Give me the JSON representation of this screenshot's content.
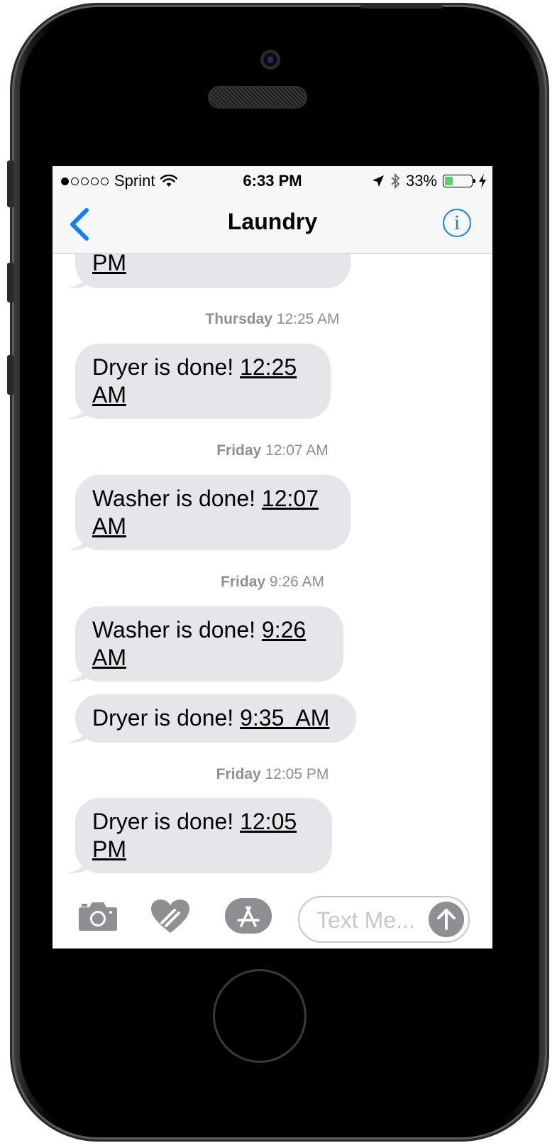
{
  "status_bar": {
    "carrier": "Sprint",
    "time": "6:33 PM",
    "battery_percent": "33%",
    "battery_level": 0.33,
    "battery_color": "#4cd964",
    "signal_bars": 1,
    "icons": [
      "wifi-icon",
      "location-arrow-icon",
      "bluetooth-icon",
      "battery-icon",
      "charging-bolt-icon"
    ]
  },
  "nav": {
    "title": "Laundry",
    "back_icon": "chevron-left-icon",
    "info_icon": "info-icon",
    "info_glyph": "i",
    "accent_color": "#147efb"
  },
  "messages": [
    {
      "type": "bubble",
      "text": "",
      "time": "PM",
      "partial": true
    },
    {
      "type": "timestamp",
      "day": "Thursday",
      "time": "12:25 AM"
    },
    {
      "type": "bubble",
      "text": "Dryer is done! ",
      "time_line1": "12:25",
      "time_line2": "AM"
    },
    {
      "type": "timestamp",
      "day": "Friday",
      "time": "12:07 AM"
    },
    {
      "type": "bubble",
      "text": "Washer is done! ",
      "time_line1": "12:07",
      "time_line2": "AM"
    },
    {
      "type": "timestamp",
      "day": "Friday",
      "time": "9:26 AM"
    },
    {
      "type": "bubble",
      "text": "Washer is done! ",
      "time_line1": "9:26",
      "time_line2": "AM"
    },
    {
      "type": "bubble",
      "text": "Dryer is done! ",
      "time_line1": "9:35  AM"
    },
    {
      "type": "timestamp",
      "day": "Friday",
      "time": "12:05 PM"
    },
    {
      "type": "bubble",
      "text": "Dryer is done! ",
      "time_line1": "12:05",
      "time_line2": "PM"
    }
  ],
  "input_bar": {
    "camera_icon": "camera-icon",
    "digital_touch_icon": "heart-hands-icon",
    "app_store_icon": "app-store-icon",
    "placeholder": "Text Me...",
    "send_icon": "send-arrow-up-icon"
  },
  "colors": {
    "bubble_gray": "#e5e5ea",
    "timestamp_gray": "#8e8e93",
    "icon_gray": "#8e8e93"
  }
}
